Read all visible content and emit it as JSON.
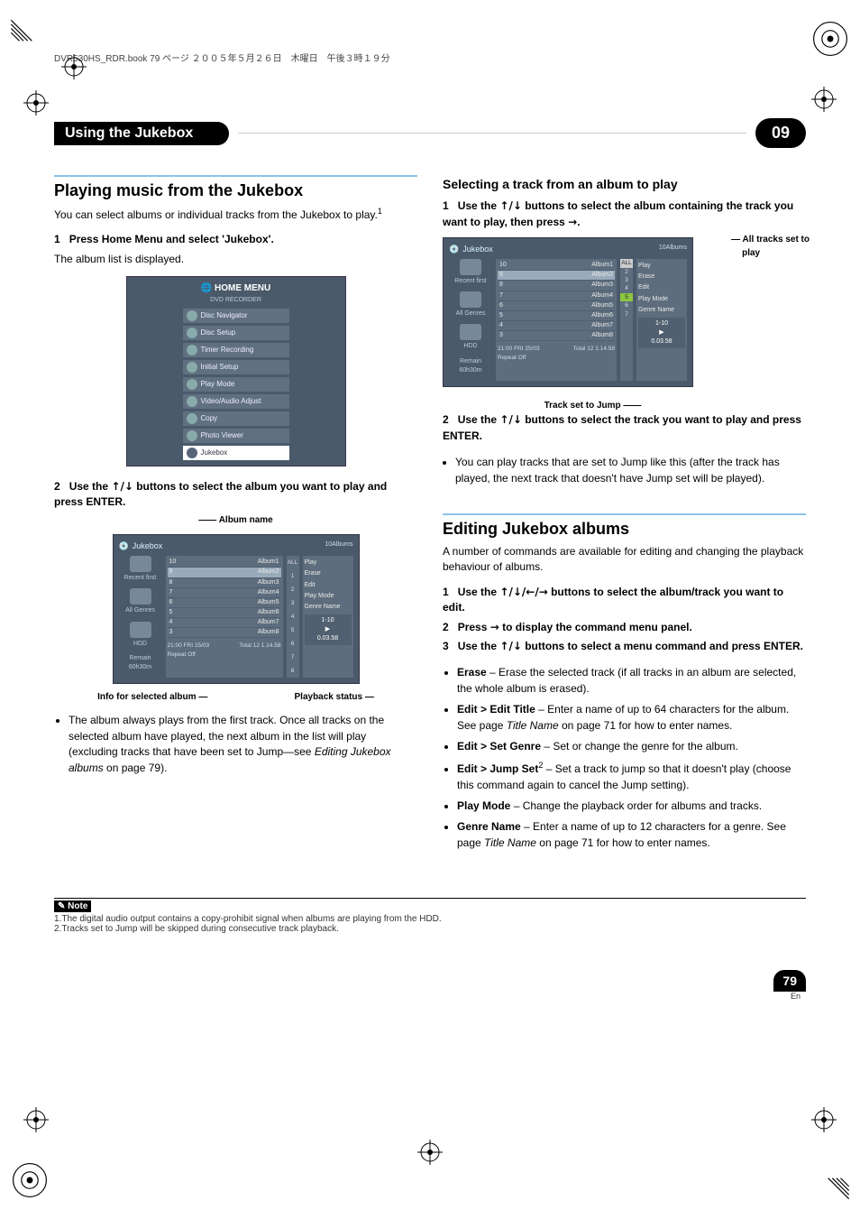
{
  "page_header": {
    "bookline": "DVR530HS_RDR.book  79 ページ  ２００５年５月２６日　木曜日　午後３時１９分"
  },
  "title_bar": {
    "chapter_title": "Using the Jukebox",
    "chapter_num": "09"
  },
  "left": {
    "h2": "Playing music from the Jukebox",
    "intro1": "You can select albums or individual tracks from the Jukebox to play.",
    "footref1": "1",
    "step1_n": "1",
    "step1_b": "Press Home Menu and select 'Jukebox'.",
    "step1_after": "The album list is displayed.",
    "home_menu": {
      "title": "HOME MENU",
      "sub": "DVD RECORDER",
      "items": [
        "Disc Navigator",
        "Disc Setup",
        "Timer Recording",
        "Initial Setup",
        "Play Mode",
        "Video/Audio Adjust",
        "Copy",
        "Photo Viewer",
        "Jukebox"
      ]
    },
    "step2_n": "2",
    "step2_pre": "Use the  ",
    "step2_arrows": "↑/↓",
    "step2_post": "  buttons to select the album you want to play and press ENTER.",
    "album_caption": "Album name",
    "jukebox_shot": {
      "title": "Jukebox",
      "albums_count": "10Albums",
      "side": [
        "Recent first",
        "All Genres",
        "HDD",
        "Remain",
        "60h30m"
      ],
      "albums": [
        {
          "n": "10",
          "name": "Album1"
        },
        {
          "n": "9",
          "name": "Album2"
        },
        {
          "n": "8",
          "name": "Album3"
        },
        {
          "n": "7",
          "name": "Album4"
        },
        {
          "n": "6",
          "name": "Album5"
        },
        {
          "n": "5",
          "name": "Album6"
        },
        {
          "n": "4",
          "name": "Album7"
        },
        {
          "n": "3",
          "name": "Album8"
        }
      ],
      "right_nums": [
        "ALL",
        "1",
        "2",
        "3",
        "4",
        "5",
        "6",
        "7",
        "8"
      ],
      "cmd_menu": [
        "Play",
        "Erase",
        "Edit",
        "Play Mode",
        "Genre Name"
      ],
      "status_time": "21:00  FRI  25/03",
      "status_repeat": "Repeat Off",
      "status_total": "Total 12  1.14.58",
      "status_range": "1-10",
      "status_elapsed": "0.03.58"
    },
    "info_caption_left": "Info for selected album",
    "info_caption_right": "Playback status",
    "bullet1": "The album always plays from the first track. Once all tracks on the selected album have played, the next album in the list will play (excluding tracks that have been set to Jump—see ",
    "bullet1_em": "Editing Jukebox albums",
    "bullet1_after": " on page 79)."
  },
  "right": {
    "subsection": "Selecting a track from an album to play",
    "step1_n": "1",
    "step1_pre": "Use the  ",
    "step1_arrows": "↑/↓",
    "step1_mid": "  buttons to select the album containing the track you want to play, then press  ",
    "step1_arrow2": "→",
    "step1_end": ".",
    "side_label_1a": "All tracks set to",
    "side_label_1b": "play",
    "side_label_2": "Track set to Jump",
    "step2_n": "2",
    "step2_pre": "Use the  ",
    "step2_arrows": "↑/↓",
    "step2_post": "  buttons to select the track you want to play and press ENTER.",
    "sub_bullet": "You can play tracks that are set to Jump like this (after the track has played, the next track that doesn't have Jump set will be played).",
    "h2": "Editing Jukebox albums",
    "intro": "A number of commands are available for editing and changing the playback behaviour of albums.",
    "estep1_n": "1",
    "estep1_pre": "Use the  ",
    "estep1_arrows": "↑/↓/←/→",
    "estep1_post": "  buttons to select the album/track you want to edit.",
    "estep2_n": "2",
    "estep2_pre": "Press  ",
    "estep2_arrow": "→",
    "estep2_post": "  to display the command menu panel.",
    "estep3_n": "3",
    "estep3_pre": "Use the  ",
    "estep3_arrows": "↑/↓",
    "estep3_post": "  buttons to select a menu command and press ENTER.",
    "cmds": [
      {
        "b": "Erase",
        "t": " – Erase the selected track (if all tracks in an album are selected, the whole album is erased)."
      },
      {
        "b": "Edit > Edit Title",
        "t": " – Enter a name of up to 64 characters for the album. See page ",
        "em": "Title Name",
        "t2": " on page 71 for how to enter names."
      },
      {
        "b": "Edit > Set Genre",
        "t": " – Set or change the genre for the album."
      },
      {
        "b": "Edit > Jump Set",
        "sup": "2",
        "t": " – Set a track to jump so that it doesn't play (choose this command again to cancel the Jump setting)."
      },
      {
        "b": "Play Mode",
        "t": " – Change the playback order for albums and tracks."
      },
      {
        "b": "Genre Name",
        "t": " – Enter a name of up to 12 characters for a genre. See page ",
        "em": "Title Name",
        "t2": " on page 71 for how to enter names."
      }
    ]
  },
  "notes": {
    "label": "Note",
    "n1": "1.The digital audio output contains a copy-prohibit signal when albums are playing from the HDD.",
    "n2": "2.Tracks set to Jump will be skipped during consecutive track playback."
  },
  "footer": {
    "page": "79",
    "lang": "En"
  }
}
